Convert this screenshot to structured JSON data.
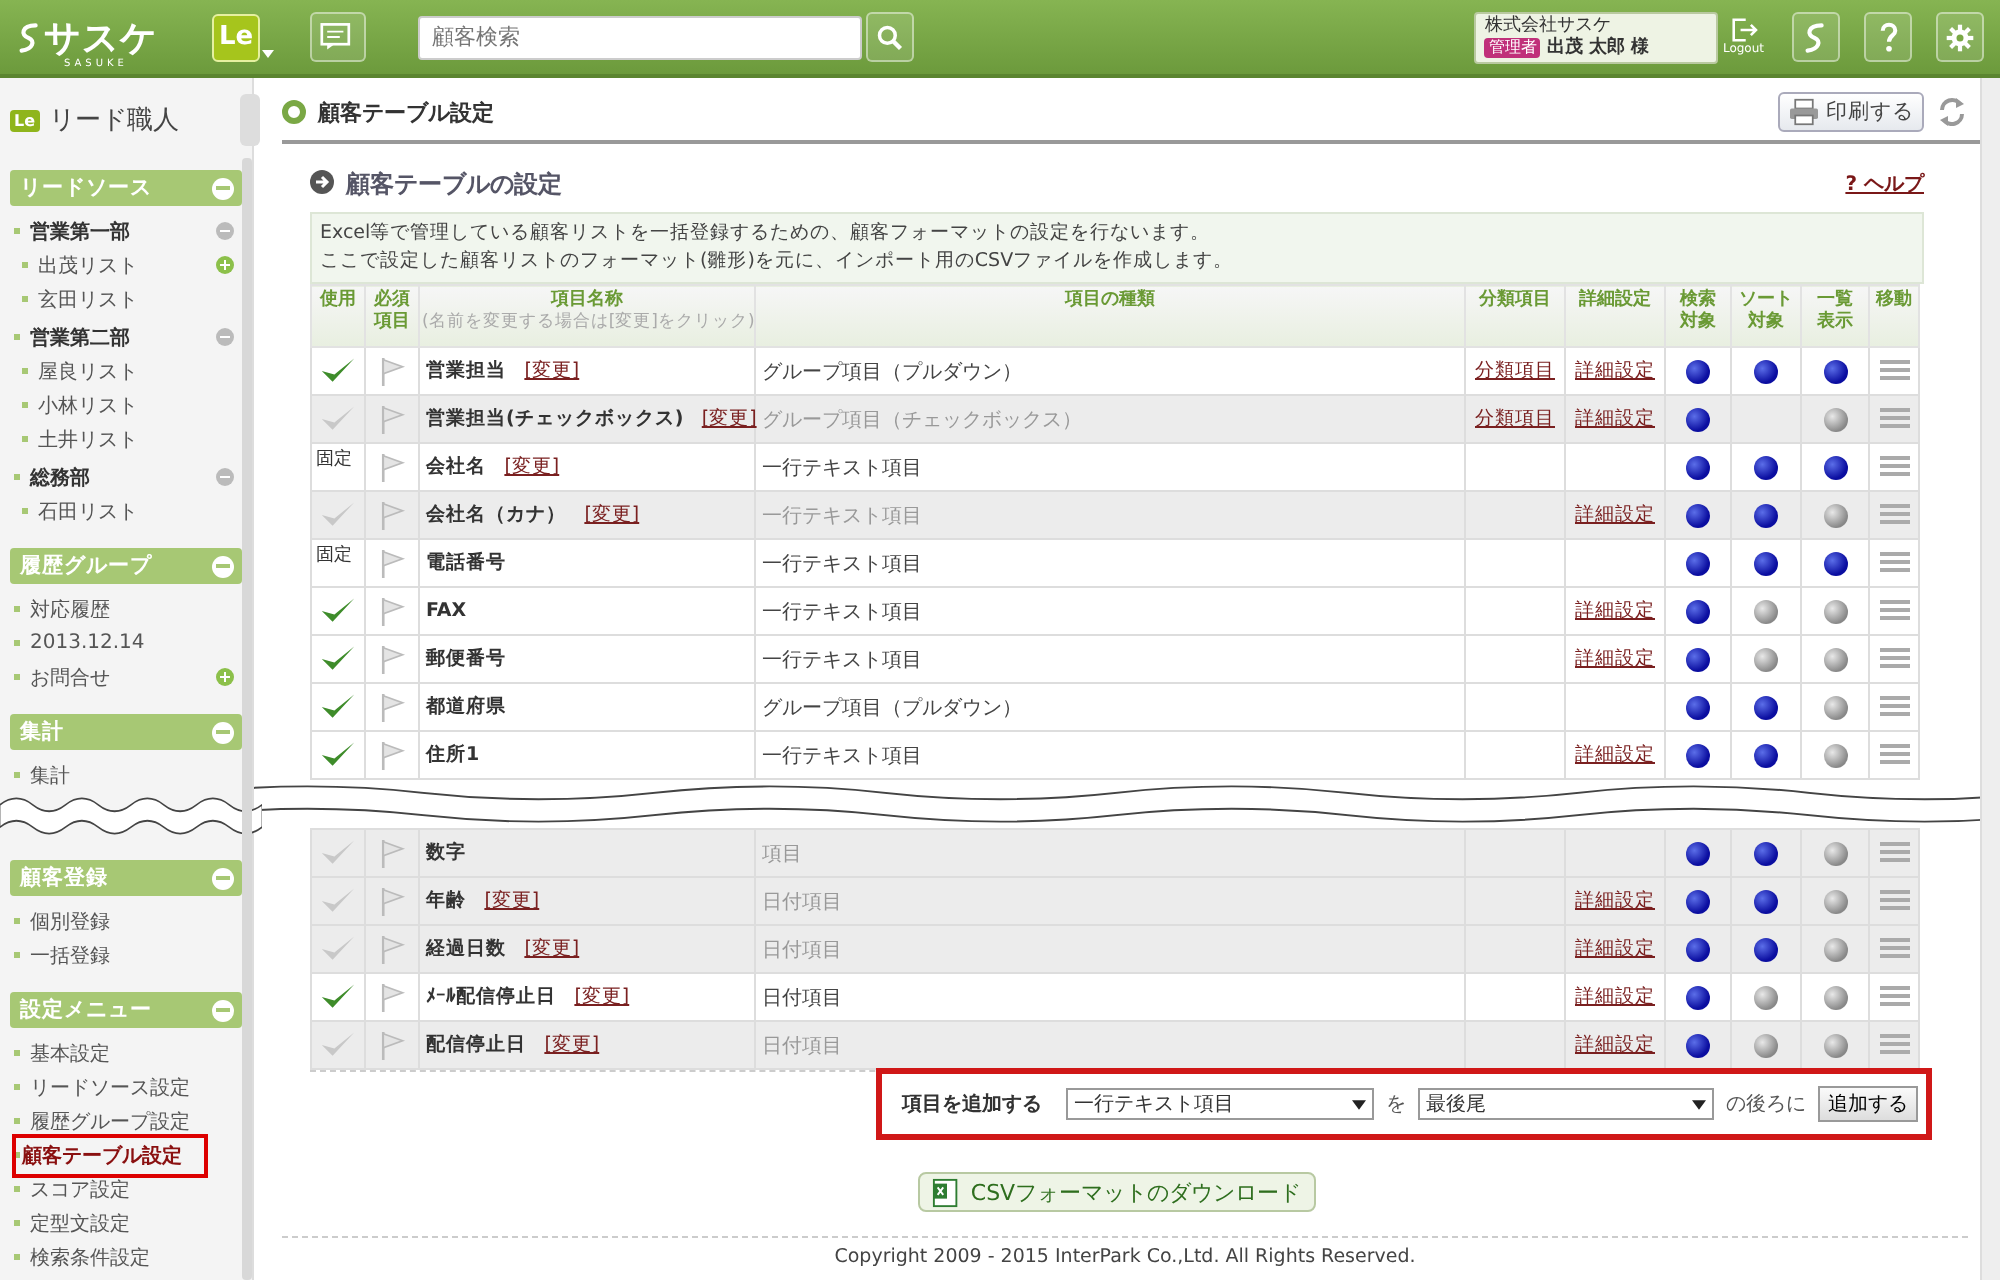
{
  "header": {
    "logo": "サスケ",
    "logo_sub": "SASUKE",
    "app_badge": "Le",
    "search": {
      "placeholder": "顧客検索"
    },
    "company": "株式会社サスケ",
    "role": "管理者",
    "user": "出茂 太郎 様",
    "logout": "Logout"
  },
  "sidebar": {
    "badge": "Le",
    "title": "リード職人",
    "sections": [
      {
        "title": "リードソース",
        "expanded": true,
        "items": [
          {
            "label": "営業第一部",
            "expanded": true,
            "children": [
              {
                "label": "出茂リスト",
                "add_button": true
              },
              {
                "label": "玄田リスト"
              }
            ]
          },
          {
            "label": "営業第二部",
            "expanded": true,
            "children": [
              {
                "label": "屋良リスト"
              },
              {
                "label": "小林リスト"
              },
              {
                "label": "土井リスト"
              }
            ]
          },
          {
            "label": "総務部",
            "expanded": true,
            "children": [
              {
                "label": "石田リスト"
              }
            ]
          }
        ]
      },
      {
        "title": "履歴グループ",
        "expanded": true,
        "items": [
          {
            "label": "対応履歴"
          },
          {
            "label": "2013.12.14"
          },
          {
            "label": "お問合せ",
            "add_button": true
          }
        ]
      },
      {
        "title": "集計",
        "expanded": true,
        "break_after": true,
        "items": [
          {
            "label": "集計"
          }
        ]
      },
      {
        "title": "顧客登録",
        "expanded": true,
        "items": [
          {
            "label": "個別登録"
          },
          {
            "label": "一括登録"
          }
        ]
      },
      {
        "title": "設定メニュー",
        "expanded": true,
        "items": [
          {
            "label": "基本設定",
            "selected": false
          },
          {
            "label": "リードソース設定",
            "selected": false
          },
          {
            "label": "履歴グループ設定",
            "selected": false
          },
          {
            "label": "顧客テーブル設定",
            "selected": true
          },
          {
            "label": "スコア設定",
            "selected": false
          },
          {
            "label": "定型文設定",
            "selected": false
          },
          {
            "label": "検索条件設定",
            "selected": false
          }
        ]
      }
    ]
  },
  "page": {
    "title": "顧客テーブル設定",
    "print": "印刷する",
    "section_title": "顧客テーブルの設定",
    "help": "? ヘルプ",
    "description": [
      "Excel等で管理している顧客リストを一括登録するための、顧客フォーマットの設定を行ないます。",
      "ここで設定した顧客リストのフォーマット(雛形)を元に、インポート用のCSVファイルを作成します。"
    ]
  },
  "table": {
    "columns": [
      {
        "label": "使用"
      },
      {
        "label": "必須項目",
        "wrap": true
      },
      {
        "label": "項目名称",
        "sub": "(名前を変更する場合は[変更]をクリック)"
      },
      {
        "label": "項目の種類"
      },
      {
        "label": "分類項目"
      },
      {
        "label": "詳細設定"
      },
      {
        "label": "検索対象",
        "wrap": true
      },
      {
        "label": "ソート対象",
        "wrap": true
      },
      {
        "label": "一覧表示",
        "wrap": true
      },
      {
        "label": "移動"
      }
    ],
    "rows": [
      {
        "kind": "check",
        "checked": true,
        "name": "営業担当",
        "change": "[変更]",
        "type": "グループ項目（プルダウン）",
        "category": "分類項目",
        "detail": "詳細設定",
        "search": true,
        "sort": true,
        "list": true
      },
      {
        "kind": "check",
        "checked": false,
        "name": "営業担当(チェックボックス)",
        "change": "[変更]",
        "type": "グループ項目（チェックボックス）",
        "category": "分類項目",
        "detail": "詳細設定",
        "search": true,
        "list": false
      },
      {
        "kind": "fixed",
        "fixed_label": "固定",
        "name": "会社名",
        "change": "[変更]",
        "type": "一行テキスト項目",
        "search": true,
        "sort": true,
        "list": true
      },
      {
        "kind": "check",
        "checked": false,
        "name": "会社名（カナ）",
        "change": "[変更]",
        "type": "一行テキスト項目",
        "detail": "詳細設定",
        "search": true,
        "sort": true,
        "list": false
      },
      {
        "kind": "fixed",
        "fixed_label": "固定",
        "name": "電話番号",
        "type": "一行テキスト項目",
        "search": true,
        "sort": true,
        "list": true
      },
      {
        "kind": "check",
        "checked": true,
        "name": "FAX",
        "type": "一行テキスト項目",
        "detail": "詳細設定",
        "search": true,
        "sort": false,
        "list": false
      },
      {
        "kind": "check",
        "checked": true,
        "name": "郵便番号",
        "type": "一行テキスト項目",
        "detail": "詳細設定",
        "search": true,
        "sort": false,
        "list": false
      },
      {
        "kind": "check",
        "checked": true,
        "name": "都道府県",
        "type": "グループ項目（プルダウン）",
        "search": true,
        "sort": true,
        "list": false
      },
      {
        "kind": "check",
        "checked": true,
        "name": "住所1",
        "type": "一行テキスト項目",
        "detail": "詳細設定",
        "search": true,
        "sort": true,
        "list": false,
        "break_after": true
      },
      {
        "kind": "check",
        "checked": false,
        "name": "数字",
        "type": "項目",
        "search": true,
        "sort": true,
        "list": false
      },
      {
        "kind": "check",
        "checked": false,
        "name": "年齢",
        "change": "[変更]",
        "type": "日付項目",
        "detail": "詳細設定",
        "search": true,
        "sort": true,
        "list": false
      },
      {
        "kind": "check",
        "checked": false,
        "name": "経過日数",
        "change": "[変更]",
        "type": "日付項目",
        "detail": "詳細設定",
        "search": true,
        "sort": true,
        "list": false
      },
      {
        "kind": "check",
        "checked": true,
        "name": "ﾒｰﾙ配信停止日",
        "change": "[変更]",
        "type": "日付項目",
        "detail": "詳細設定",
        "search": true,
        "sort": false,
        "list": false
      },
      {
        "kind": "check",
        "checked": false,
        "name": "配信停止日",
        "change": "[変更]",
        "type": "日付項目",
        "detail": "詳細設定",
        "search": true,
        "sort": false,
        "list": false
      }
    ]
  },
  "add_item": {
    "label": "項目を追加する",
    "type_select": "一行テキスト項目",
    "joiner": "を",
    "position_select": "最後尾",
    "suffix": "の後ろに",
    "button": "追加する"
  },
  "csv_button": "CSVフォーマットのダウンロード",
  "footer": "Copyright 2009 - 2015 InterPark Co.,Ltd. All Rights Reserved."
}
